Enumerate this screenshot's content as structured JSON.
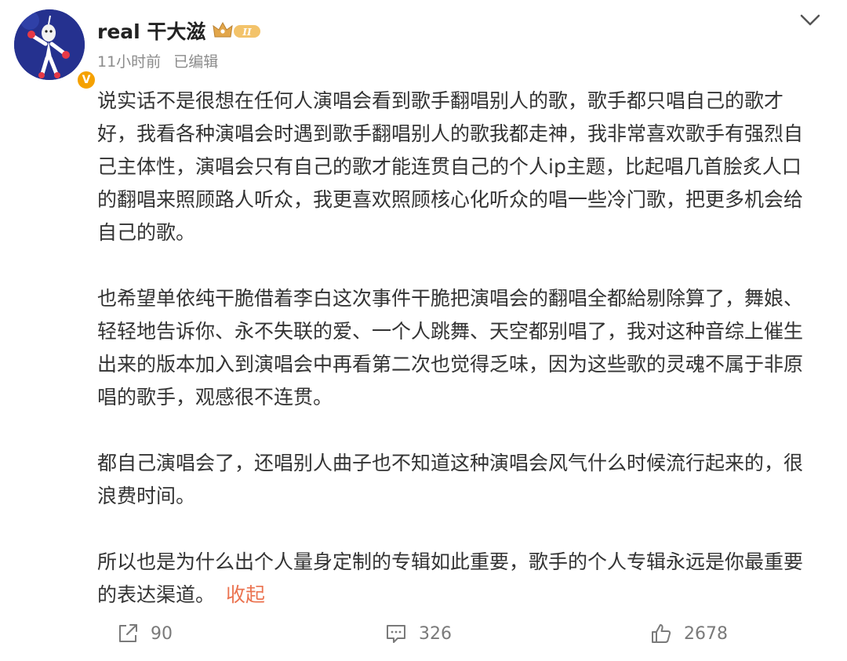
{
  "post": {
    "username": "real 干大滋",
    "vip_level": "II",
    "time": "11小时前",
    "edited": "已编辑",
    "paragraphs": [
      "说实话不是很想在任何人演唱会看到歌手翻唱别人的歌，歌手都只唱自己的歌才\n好，我看各种演唱会时遇到歌手翻唱别人的歌我都走神，我非常喜欢歌手有强烈自\n己主体性，演唱会只有自己的歌才能连贯自己的个人ip主题，比起唱几首脍炙人口\n的翻唱来照顾路人听众，我更喜欢照顾核心化听众的唱一些冷门歌，把更多机会给\n自己的歌。",
      "也希望单依纯干脆借着李白这次事件干脆把演唱会的翻唱全都給剔除算了，舞娘、\n轻轻地告诉你、永不失联的爱、一个人跳舞、天空都别唱了，我对这种音综上催生\n出来的版本加入到演唱会中再看第二次也觉得乏味，因为这些歌的灵魂不属于非原\n唱的歌手，观感很不连贯。",
      "都自己演唱会了，还唱别人曲子也不知道这种演唱会风气什么时候流行起来的，很\n浪费时间。",
      "所以也是为什么出个人量身定制的专辑如此重要，歌手的个人专辑永远是你最重要\n的表达渠道。"
    ],
    "collapse_label": "收起"
  },
  "actions": {
    "repost_count": "90",
    "comment_count": "326",
    "like_count": "2678"
  },
  "colors": {
    "accent_link": "#eb7350",
    "verified_badge": "#f5a100",
    "meta_text": "#8b8b8b",
    "body_text": "#333333"
  },
  "icons": {
    "avatar": "cartoon-figure-avatar",
    "verified": "verified-v-icon",
    "vip": "vip-crown-icon",
    "menu": "chevron-down-icon",
    "repost": "repost-icon",
    "comment": "comment-icon",
    "like": "like-icon"
  }
}
